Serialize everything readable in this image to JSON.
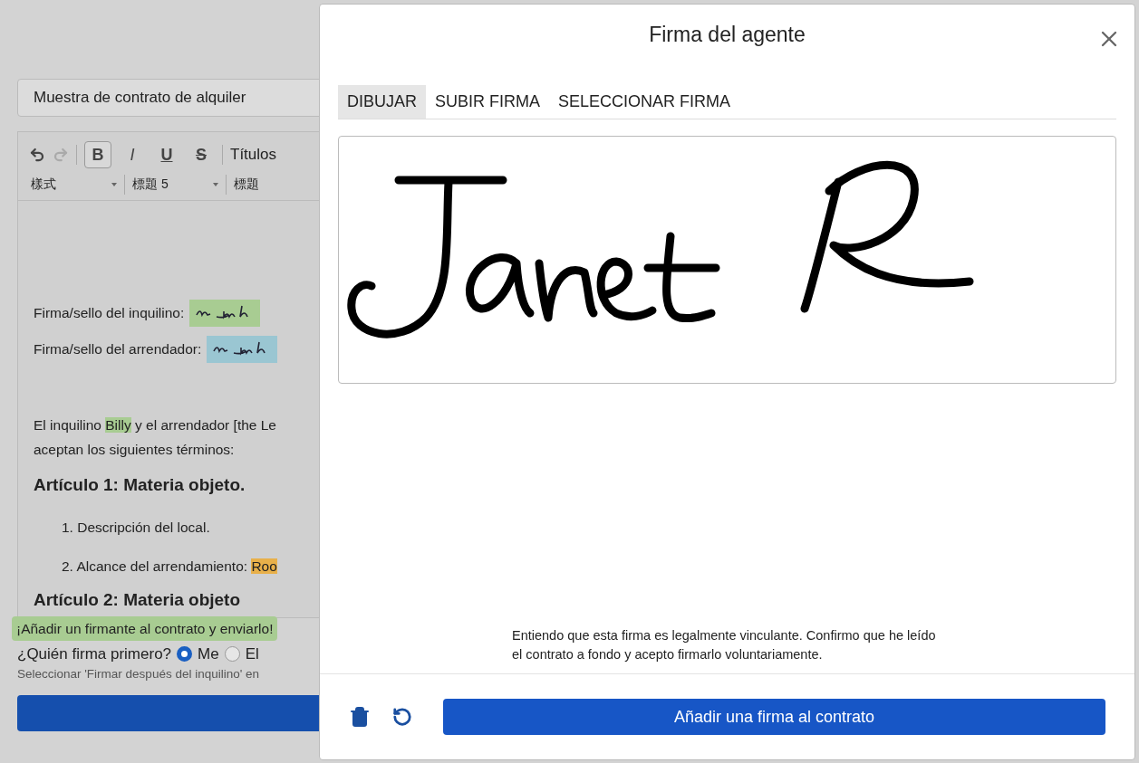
{
  "document_title": "Muestra de contrato de alquiler",
  "history": [
    {
      "kind": "undo",
      "disabled": false
    },
    {
      "kind": "redo",
      "disabled": true
    }
  ],
  "format_buttons": [
    {
      "kind": "bold",
      "label": "B",
      "selected": true
    },
    {
      "kind": "italic",
      "label": "I",
      "selected": false
    },
    {
      "kind": "underline",
      "label": "U",
      "selected": false
    },
    {
      "kind": "strike",
      "label": "S",
      "selected": false
    }
  ],
  "headings_label": "Títulos",
  "dropdowns": [
    "樣式",
    "標題 5",
    "標題"
  ],
  "signature_fields": [
    {
      "label": "Firma/sello del inquilino:",
      "color": "#a8cc92"
    },
    {
      "label": "Firma/sello del arrendador:",
      "color": "#9ac6d2"
    }
  ],
  "paragraph": {
    "before": "El inquilino ",
    "highlight": "Billy",
    "after": " y el arrendador [the Le",
    "continuation": "aceptan los siguientes términos:"
  },
  "articles": [
    {
      "heading": "Artículo 1: Materia objeto.",
      "items": [
        {
          "number": "1.",
          "text": "Descripción del local."
        },
        {
          "number": "2.",
          "text": "Alcance del arrendamiento: ",
          "highlight": "Roo"
        }
      ]
    },
    {
      "heading": "Artículo 2: Materia objeto"
    }
  ],
  "banner": "¡Añadir un firmante al contrato y enviarlo!",
  "who_signs": {
    "label": "¿Quién firma primero?",
    "options": [
      {
        "label": "Me",
        "selected": true
      },
      {
        "label": "El",
        "selected": false
      }
    ]
  },
  "hint": "Seleccionar 'Firmar después del inquilino' en",
  "modal": {
    "title": "Firma del agente",
    "tabs": [
      {
        "label": "DIBUJAR",
        "selected": true
      },
      {
        "label": "SUBIR FIRMA",
        "selected": false
      },
      {
        "label": "SELECCIONAR FIRMA",
        "selected": false
      }
    ],
    "disclaimer": "Entiendo que esta firma es legalmente vinculante. Confirmo que he leído el contrato a fondo y acepto firmarlo voluntariamente.",
    "submit": "Añadir una firma al contrato"
  }
}
